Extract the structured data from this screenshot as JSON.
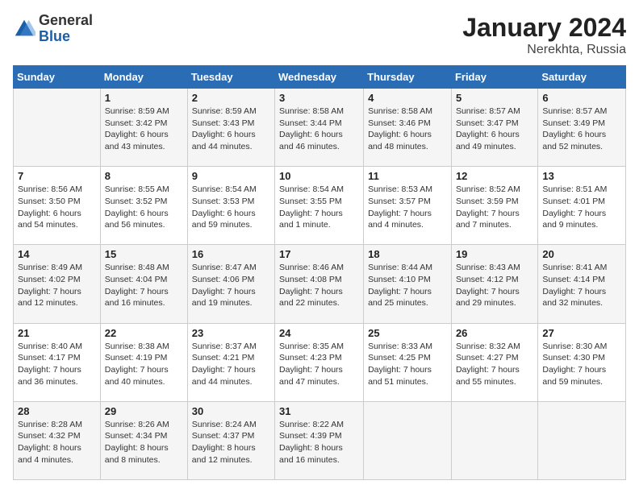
{
  "header": {
    "logo": {
      "general": "General",
      "blue": "Blue"
    },
    "title": "January 2024",
    "location": "Nerekhta, Russia"
  },
  "calendar": {
    "days_of_week": [
      "Sunday",
      "Monday",
      "Tuesday",
      "Wednesday",
      "Thursday",
      "Friday",
      "Saturday"
    ],
    "weeks": [
      [
        {
          "day": "",
          "info": ""
        },
        {
          "day": "1",
          "info": "Sunrise: 8:59 AM\nSunset: 3:42 PM\nDaylight: 6 hours\nand 43 minutes."
        },
        {
          "day": "2",
          "info": "Sunrise: 8:59 AM\nSunset: 3:43 PM\nDaylight: 6 hours\nand 44 minutes."
        },
        {
          "day": "3",
          "info": "Sunrise: 8:58 AM\nSunset: 3:44 PM\nDaylight: 6 hours\nand 46 minutes."
        },
        {
          "day": "4",
          "info": "Sunrise: 8:58 AM\nSunset: 3:46 PM\nDaylight: 6 hours\nand 48 minutes."
        },
        {
          "day": "5",
          "info": "Sunrise: 8:57 AM\nSunset: 3:47 PM\nDaylight: 6 hours\nand 49 minutes."
        },
        {
          "day": "6",
          "info": "Sunrise: 8:57 AM\nSunset: 3:49 PM\nDaylight: 6 hours\nand 52 minutes."
        }
      ],
      [
        {
          "day": "7",
          "info": "Sunrise: 8:56 AM\nSunset: 3:50 PM\nDaylight: 6 hours\nand 54 minutes."
        },
        {
          "day": "8",
          "info": "Sunrise: 8:55 AM\nSunset: 3:52 PM\nDaylight: 6 hours\nand 56 minutes."
        },
        {
          "day": "9",
          "info": "Sunrise: 8:54 AM\nSunset: 3:53 PM\nDaylight: 6 hours\nand 59 minutes."
        },
        {
          "day": "10",
          "info": "Sunrise: 8:54 AM\nSunset: 3:55 PM\nDaylight: 7 hours\nand 1 minute."
        },
        {
          "day": "11",
          "info": "Sunrise: 8:53 AM\nSunset: 3:57 PM\nDaylight: 7 hours\nand 4 minutes."
        },
        {
          "day": "12",
          "info": "Sunrise: 8:52 AM\nSunset: 3:59 PM\nDaylight: 7 hours\nand 7 minutes."
        },
        {
          "day": "13",
          "info": "Sunrise: 8:51 AM\nSunset: 4:01 PM\nDaylight: 7 hours\nand 9 minutes."
        }
      ],
      [
        {
          "day": "14",
          "info": "Sunrise: 8:49 AM\nSunset: 4:02 PM\nDaylight: 7 hours\nand 12 minutes."
        },
        {
          "day": "15",
          "info": "Sunrise: 8:48 AM\nSunset: 4:04 PM\nDaylight: 7 hours\nand 16 minutes."
        },
        {
          "day": "16",
          "info": "Sunrise: 8:47 AM\nSunset: 4:06 PM\nDaylight: 7 hours\nand 19 minutes."
        },
        {
          "day": "17",
          "info": "Sunrise: 8:46 AM\nSunset: 4:08 PM\nDaylight: 7 hours\nand 22 minutes."
        },
        {
          "day": "18",
          "info": "Sunrise: 8:44 AM\nSunset: 4:10 PM\nDaylight: 7 hours\nand 25 minutes."
        },
        {
          "day": "19",
          "info": "Sunrise: 8:43 AM\nSunset: 4:12 PM\nDaylight: 7 hours\nand 29 minutes."
        },
        {
          "day": "20",
          "info": "Sunrise: 8:41 AM\nSunset: 4:14 PM\nDaylight: 7 hours\nand 32 minutes."
        }
      ],
      [
        {
          "day": "21",
          "info": "Sunrise: 8:40 AM\nSunset: 4:17 PM\nDaylight: 7 hours\nand 36 minutes."
        },
        {
          "day": "22",
          "info": "Sunrise: 8:38 AM\nSunset: 4:19 PM\nDaylight: 7 hours\nand 40 minutes."
        },
        {
          "day": "23",
          "info": "Sunrise: 8:37 AM\nSunset: 4:21 PM\nDaylight: 7 hours\nand 44 minutes."
        },
        {
          "day": "24",
          "info": "Sunrise: 8:35 AM\nSunset: 4:23 PM\nDaylight: 7 hours\nand 47 minutes."
        },
        {
          "day": "25",
          "info": "Sunrise: 8:33 AM\nSunset: 4:25 PM\nDaylight: 7 hours\nand 51 minutes."
        },
        {
          "day": "26",
          "info": "Sunrise: 8:32 AM\nSunset: 4:27 PM\nDaylight: 7 hours\nand 55 minutes."
        },
        {
          "day": "27",
          "info": "Sunrise: 8:30 AM\nSunset: 4:30 PM\nDaylight: 7 hours\nand 59 minutes."
        }
      ],
      [
        {
          "day": "28",
          "info": "Sunrise: 8:28 AM\nSunset: 4:32 PM\nDaylight: 8 hours\nand 4 minutes."
        },
        {
          "day": "29",
          "info": "Sunrise: 8:26 AM\nSunset: 4:34 PM\nDaylight: 8 hours\nand 8 minutes."
        },
        {
          "day": "30",
          "info": "Sunrise: 8:24 AM\nSunset: 4:37 PM\nDaylight: 8 hours\nand 12 minutes."
        },
        {
          "day": "31",
          "info": "Sunrise: 8:22 AM\nSunset: 4:39 PM\nDaylight: 8 hours\nand 16 minutes."
        },
        {
          "day": "",
          "info": ""
        },
        {
          "day": "",
          "info": ""
        },
        {
          "day": "",
          "info": ""
        }
      ]
    ]
  }
}
